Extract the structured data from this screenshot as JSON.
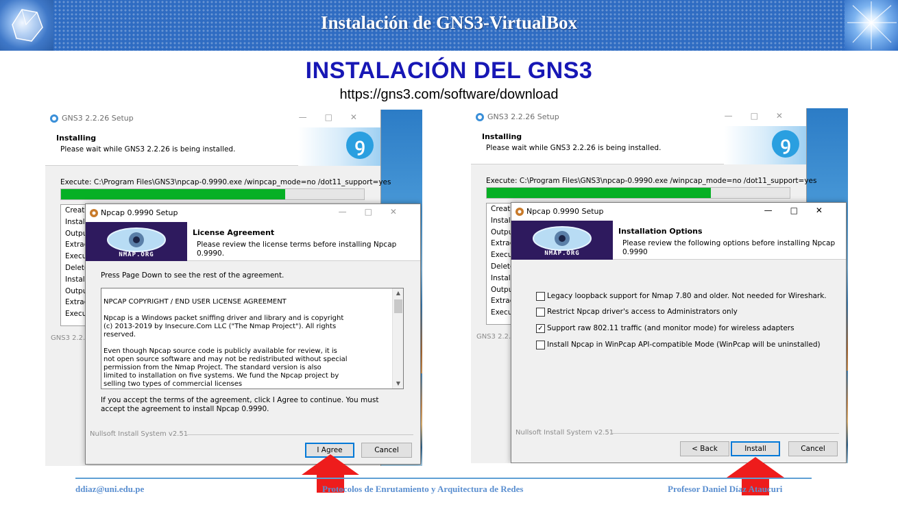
{
  "slide": {
    "header_title": "Instalación de GNS3-VirtualBox",
    "title": "INSTALACIÓN DEL GNS3",
    "url": "https://gns3.com/software/download",
    "accent_color": "#1717b5",
    "footer": {
      "email": "ddiaz@uni.edu.pe",
      "course": "Protocolos de Enrutamiento y Arquitectura de Redes",
      "professor": "Profesor Daniel Díaz Ataucuri"
    }
  },
  "gns3_setup": {
    "window_title": "GNS3 2.2.26 Setup",
    "heading": "Installing",
    "subheading": "Please wait while GNS3 2.2.26 is being installed.",
    "execute_line": "Execute: C:\\Program Files\\GNS3\\npcap-0.9990.exe /winpcap_mode=no /dot11_support=yes",
    "progress_fraction": 0.74,
    "log_items": [
      "Create",
      "Install",
      "Output",
      "Extract",
      "Execute",
      "Delete",
      "Install",
      "Output",
      "Extract",
      "Execute"
    ],
    "footer_label": "GNS3 2.2.26",
    "progress_color": "#06b025"
  },
  "npcap_license": {
    "window_title": "Npcap 0.9990 Setup",
    "banner_text": "NMAP.ORG",
    "heading": "License Agreement",
    "subheading": "Please review the license terms before installing Npcap 0.9990.",
    "instruction": "Press Page Down to see the rest of the agreement.",
    "license_text": "NPCAP COPYRIGHT / END USER LICENSE AGREEMENT\n\nNpcap is a Windows packet sniffing driver and library and is copyright\n(c) 2013-2019 by Insecure.Com LLC (\"The Nmap Project\").  All rights\nreserved.\n\nEven though Npcap source code is publicly available for review, it is\nnot open source software and may not be redistributed without special\npermission from the Nmap Project.  The standard version is also\nlimited to installation on five systems. We fund the Npcap project by\nselling two types of commercial licenses",
    "accept_text": "If you accept the terms of the agreement, click I Agree to continue. You must accept the agreement to install Npcap 0.9990.",
    "system_label": "Nullsoft Install System v2.51",
    "buttons": {
      "agree": "I Agree",
      "cancel": "Cancel"
    }
  },
  "npcap_options": {
    "window_title": "Npcap 0.9990 Setup",
    "banner_text": "NMAP.ORG",
    "heading": "Installation Options",
    "subheading": "Please review the following options before installing Npcap 0.9990",
    "options": [
      {
        "label": "Legacy loopback support for Nmap 7.80 and older. Not needed for Wireshark.",
        "checked": false
      },
      {
        "label": "Restrict Npcap driver's access to Administrators only",
        "checked": false
      },
      {
        "label": "Support raw 802.11 traffic (and monitor mode) for wireless adapters",
        "checked": true
      },
      {
        "label": "Install Npcap in WinPcap API-compatible Mode (WinPcap will be uninstalled)",
        "checked": false
      }
    ],
    "system_label": "Nullsoft Install System v2.51",
    "buttons": {
      "back": "< Back",
      "install": "Install",
      "cancel": "Cancel"
    }
  },
  "arrow_color": "#ee1c1c"
}
